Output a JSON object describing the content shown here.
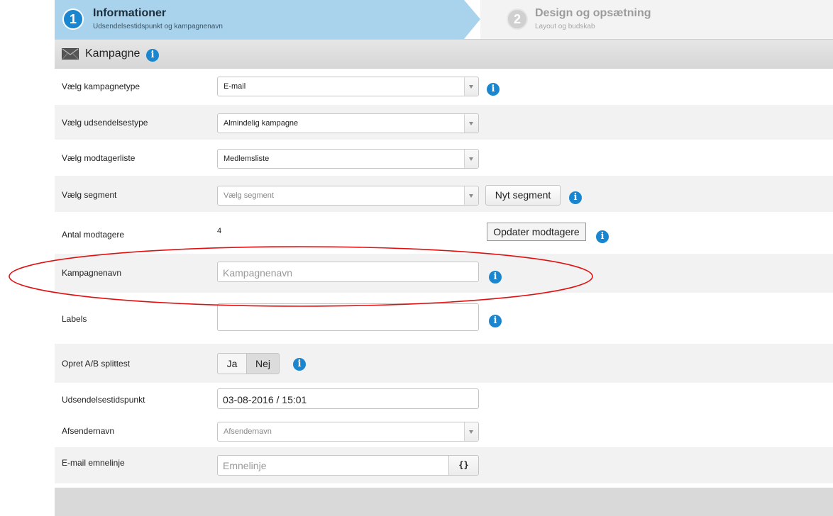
{
  "wizard": {
    "step1": {
      "number": "1",
      "title": "Informationer",
      "subtitle": "Udsendelsestidspunkt og kampagnenavn"
    },
    "step2": {
      "number": "2",
      "title": "Design og opsætning",
      "subtitle": "Layout og budskab"
    }
  },
  "section": {
    "title": "Kampagne",
    "icon": "envelope-icon"
  },
  "info_glyph": "i",
  "form": {
    "campaign_type": {
      "label": "Vælg kampagnetype",
      "value": "E-mail"
    },
    "send_type": {
      "label": "Vælg udsendelsestype",
      "value": "Almindelig kampagne"
    },
    "recipient_list": {
      "label": "Vælg modtagerliste",
      "value": "Medlemsliste"
    },
    "segment": {
      "label": "Vælg segment",
      "placeholder": "Vælg segment",
      "button": "Nyt segment"
    },
    "recipient_count": {
      "label": "Antal modtagere",
      "value": "4",
      "button": "Opdater modtagere"
    },
    "campaign_name": {
      "label": "Kampagnenavn",
      "placeholder": "Kampagnenavn"
    },
    "labels": {
      "label": "Labels",
      "value": ""
    },
    "ab_split": {
      "label": "Opret A/B splittest",
      "yes": "Ja",
      "no": "Nej",
      "selected": "Nej"
    },
    "send_time": {
      "label": "Udsendelsestidspunkt",
      "value": "03-08-2016 / 15:01"
    },
    "sender_name": {
      "label": "Afsendernavn",
      "placeholder": "Afsendernavn"
    },
    "subject": {
      "label": "E-mail emnelinje",
      "placeholder": "Emnelinje",
      "button": "{}"
    }
  },
  "colors": {
    "accent": "#1a86cf",
    "step_active_bg": "#a9d3ec",
    "highlight_oval": "#e01010"
  }
}
